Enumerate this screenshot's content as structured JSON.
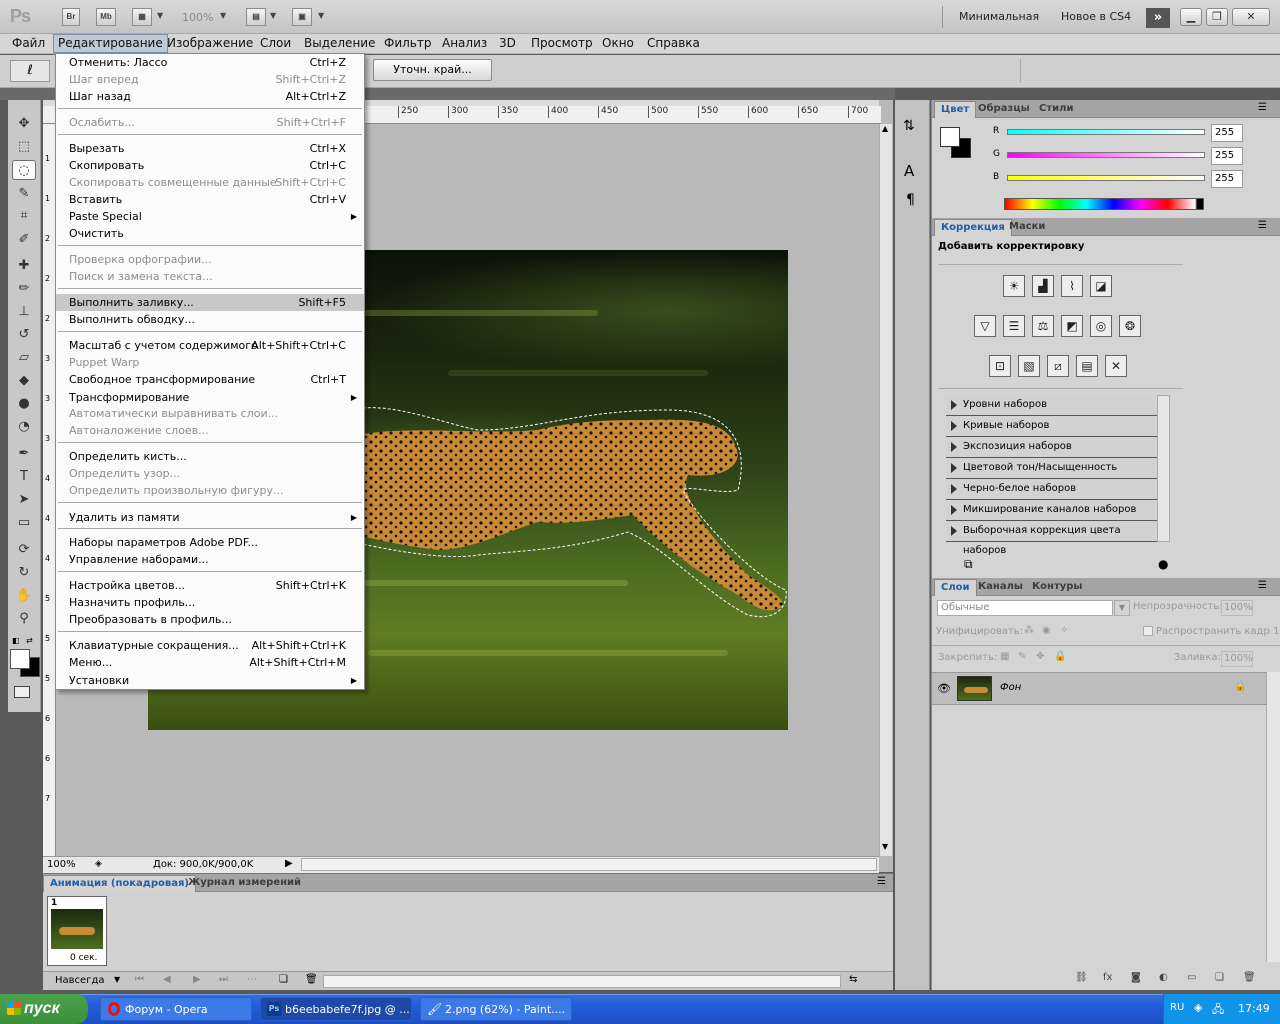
{
  "app": {
    "logo": "Ps",
    "bridge_btn": "Br",
    "minibridge_btn": "Mb",
    "zoom": "100%",
    "workspace_essentials": "Минимальная",
    "workspace_new": "Новое в CS4",
    "more_icon": "double-chevron-right-icon"
  },
  "menubar": {
    "items": [
      "Файл",
      "Редактирование",
      "Изображение",
      "Слои",
      "Выделение",
      "Фильтр",
      "Анализ",
      "3D",
      "Просмотр",
      "Окно",
      "Справка"
    ],
    "active_index": 1
  },
  "options": {
    "refine_edge": "Уточн. край..."
  },
  "edit_menu": [
    {
      "label": "Отменить: Лассо",
      "shortcut": "Ctrl+Z",
      "disabled": false
    },
    {
      "label": "Шаг вперед",
      "shortcut": "Shift+Ctrl+Z",
      "disabled": true
    },
    {
      "label": "Шаг назад",
      "shortcut": "Alt+Ctrl+Z",
      "disabled": false
    },
    {
      "label": "Ослабить...",
      "shortcut": "Shift+Ctrl+F",
      "disabled": true
    },
    {
      "label": "Вырезать",
      "shortcut": "Ctrl+X",
      "disabled": false
    },
    {
      "label": "Скопировать",
      "shortcut": "Ctrl+C",
      "disabled": false
    },
    {
      "label": "Скопировать совмещенные данные",
      "shortcut": "Shift+Ctrl+C",
      "disabled": true
    },
    {
      "label": "Вставить",
      "shortcut": "Ctrl+V",
      "disabled": false
    },
    {
      "label": "Paste Special",
      "shortcut": "",
      "disabled": false,
      "submenu": true
    },
    {
      "label": "Очистить",
      "shortcut": "",
      "disabled": false
    },
    {
      "label": "Проверка орфографии...",
      "shortcut": "",
      "disabled": true
    },
    {
      "label": "Поиск и замена текста...",
      "shortcut": "",
      "disabled": true
    },
    {
      "label": "Выполнить заливку...",
      "shortcut": "Shift+F5",
      "disabled": false,
      "highlighted": true
    },
    {
      "label": "Выполнить обводку...",
      "shortcut": "",
      "disabled": false
    },
    {
      "label": "Масштаб с учетом содержимого",
      "shortcut": "Alt+Shift+Ctrl+C",
      "disabled": false
    },
    {
      "label": "Puppet Warp",
      "shortcut": "",
      "disabled": true
    },
    {
      "label": "Свободное трансформирование",
      "shortcut": "Ctrl+T",
      "disabled": false
    },
    {
      "label": "Трансформирование",
      "shortcut": "",
      "disabled": false,
      "submenu": true
    },
    {
      "label": "Автоматически выравнивать слои...",
      "shortcut": "",
      "disabled": true
    },
    {
      "label": "Автоналожение слоев...",
      "shortcut": "",
      "disabled": true
    },
    {
      "label": "Определить кисть...",
      "shortcut": "",
      "disabled": false
    },
    {
      "label": "Определить узор...",
      "shortcut": "",
      "disabled": true
    },
    {
      "label": "Определить произвольную фигуру...",
      "shortcut": "",
      "disabled": true
    },
    {
      "label": "Удалить из памяти",
      "shortcut": "",
      "disabled": false,
      "submenu": true
    },
    {
      "label": "Наборы параметров Adobe PDF...",
      "shortcut": "",
      "disabled": false
    },
    {
      "label": "Управление наборами...",
      "shortcut": "",
      "disabled": false
    },
    {
      "label": "Настройка цветов...",
      "shortcut": "Shift+Ctrl+K",
      "disabled": false
    },
    {
      "label": "Назначить профиль...",
      "shortcut": "",
      "disabled": false
    },
    {
      "label": "Преобразовать в профиль...",
      "shortcut": "",
      "disabled": false
    },
    {
      "label": "Клавиатурные сокращения...",
      "shortcut": "Alt+Shift+Ctrl+K",
      "disabled": false
    },
    {
      "label": "Меню...",
      "shortcut": "Alt+Shift+Ctrl+M",
      "disabled": false
    },
    {
      "label": "Установки",
      "shortcut": "",
      "disabled": false,
      "submenu": true
    }
  ],
  "ruler": {
    "ticks": [
      "250",
      "300",
      "350",
      "400",
      "450",
      "500",
      "550",
      "600",
      "650",
      "700"
    ]
  },
  "ruler_v": {
    "ticks": [
      "1",
      "1",
      "2",
      "2",
      "2",
      "3",
      "3",
      "3",
      "4",
      "4",
      "4",
      "5",
      "5",
      "5",
      "6",
      "6",
      "7"
    ]
  },
  "doc_status": {
    "zoom": "100%",
    "info": "Док: 900,0K/900,0K"
  },
  "color_panel": {
    "tabs": [
      "Цвет",
      "Образцы",
      "Стили"
    ],
    "r_label": "R",
    "g_label": "G",
    "b_label": "B",
    "r": "255",
    "g": "255",
    "b": "255",
    "foreground": "#ffffff",
    "background": "#000000"
  },
  "adjust_panel": {
    "tabs": [
      "Коррекция",
      "Маски"
    ],
    "title": "Добавить корректировку",
    "presets": [
      "Уровни наборов",
      "Кривые наборов",
      "Экспозиция наборов",
      "Цветовой тон/Насыщенность наборов",
      "Черно-белое наборов",
      "Микширование каналов наборов",
      "Выборочная коррекция цвета наборов"
    ]
  },
  "layers_panel": {
    "tabs": [
      "Слои",
      "Каналы",
      "Контуры"
    ],
    "blend_mode": "Обычные",
    "opacity_label": "Непрозрачность:",
    "opacity": "100%",
    "unify_label": "Унифицировать:",
    "propagate_label": "Распространить кадр 1",
    "lock_label": "Закрепить:",
    "fill_label": "Заливка:",
    "fill": "100%",
    "layer_name": "Фон"
  },
  "animation_panel": {
    "tabs": [
      "Анимация (покадровая)",
      "Журнал измерений"
    ],
    "frame_number": "1",
    "frame_delay": "0 сек.",
    "loop": "Навсегда"
  },
  "taskbar": {
    "start": "пуск",
    "tasks": [
      "Форум - Opera",
      "b6eebabefe7f.jpg @ ...",
      "2.png (62%) - Paint...."
    ],
    "lang": "RU",
    "clock": "17:49"
  }
}
